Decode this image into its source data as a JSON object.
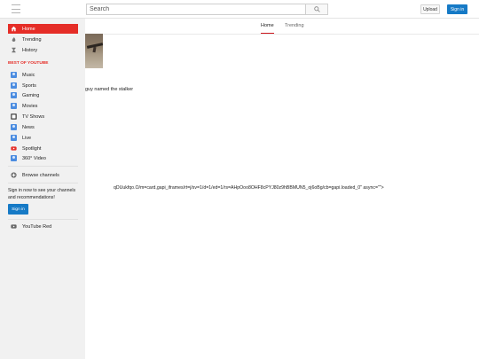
{
  "header": {
    "search_placeholder": "Search",
    "upload_label": "Upload",
    "signin_label": "Sign in",
    "accent_color": "#167ac6"
  },
  "sidebar": {
    "primary": [
      {
        "label": "Home",
        "icon": "home-icon",
        "active": true
      },
      {
        "label": "Trending",
        "icon": "flame-icon"
      },
      {
        "label": "History",
        "icon": "hourglass-icon"
      }
    ],
    "section_title": "BEST OF YOUTUBE",
    "channels": [
      {
        "label": "Music"
      },
      {
        "label": "Sports"
      },
      {
        "label": "Gaming"
      },
      {
        "label": "Movies"
      },
      {
        "label": "TV Shows"
      },
      {
        "label": "News"
      },
      {
        "label": "Live"
      },
      {
        "label": "Spotlight"
      },
      {
        "label": "360° Video"
      }
    ],
    "browse_channels": "Browse channels",
    "signin_prompt": "Sign in now to see your channels and recommendations!",
    "signin_label": "Sign in",
    "youtube_red": "YouTube Red",
    "active_color": "#e52d27"
  },
  "main": {
    "tabs": [
      {
        "label": "Home",
        "active": true
      },
      {
        "label": "Trending"
      }
    ],
    "video_title": "guy named the stalker",
    "script_text": "qDUukfqo.O/m=card,gapi_iframes/rt=j/sv=1/d=1/ed=1/rs=AHpOoo8OHF8cPYJ80z9hBBMUN5_oj6oBg/cb=gapi.loaded_0\" async=\"\">"
  }
}
